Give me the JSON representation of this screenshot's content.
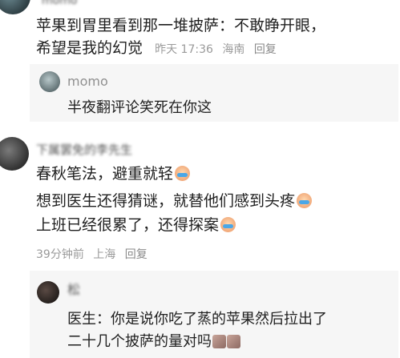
{
  "comment1": {
    "username": "momo",
    "line1": "苹果到胃里看到那一堆披萨：不敢睁开眼，",
    "line2": "希望是我的幻觉",
    "time": "昨天 17:36",
    "location": "海南",
    "reply_label": "回复"
  },
  "reply1": {
    "username": "momo",
    "text": "半夜翻评论笑死在你这"
  },
  "comment2": {
    "username": "下属罢免的李先生",
    "line1": "春秋笔法，避重就轻",
    "line2": "想到医生还得猜谜，就替他们感到头疼",
    "line3": "上班已经很累了，还得探案",
    "time": "39分钟前",
    "location": "上海",
    "reply_label": "回复",
    "emoji": "crying-laughing-emoji"
  },
  "reply2": {
    "username": "松",
    "line1": "医生：你是说你吃了蒸的苹果然后拉出了",
    "line2": "二十几个披萨的量对吗",
    "emoji": "facepalm-emoji"
  }
}
